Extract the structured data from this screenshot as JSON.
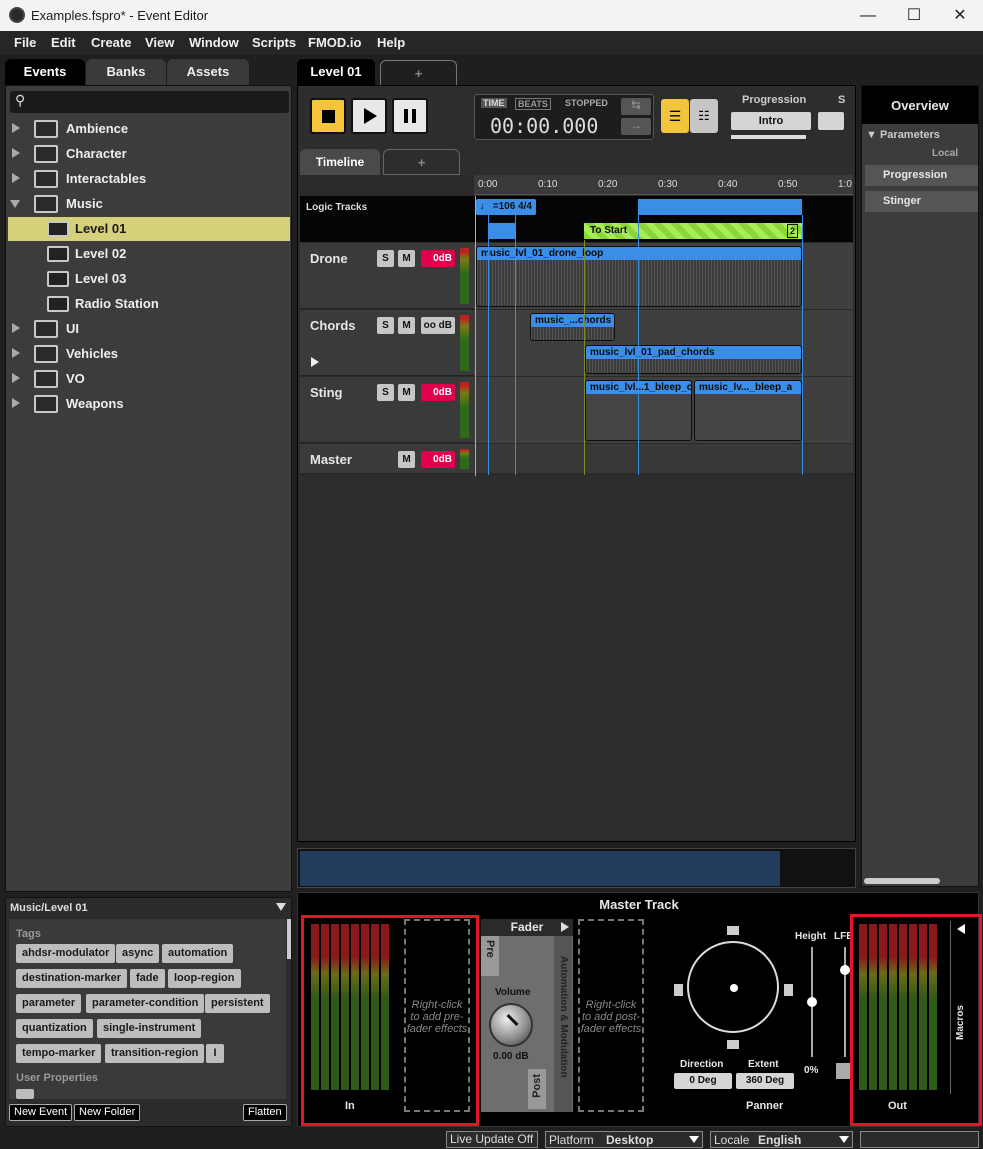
{
  "window": {
    "title": "Examples.fspro* - Event Editor",
    "minimize": "—",
    "maximize": "☐",
    "close": "✕"
  },
  "menu": [
    "File",
    "Edit",
    "Create",
    "View",
    "Window",
    "Scripts",
    "FMOD.io",
    "Help"
  ],
  "browser": {
    "tabs": [
      "Events",
      "Banks",
      "Assets"
    ],
    "search_placeholder": "",
    "tree": [
      {
        "label": "Ambience",
        "type": "folder",
        "expanded": false
      },
      {
        "label": "Character",
        "type": "folder",
        "expanded": false
      },
      {
        "label": "Interactables",
        "type": "folder",
        "expanded": false
      },
      {
        "label": "Music",
        "type": "folder",
        "expanded": true
      },
      {
        "label": "Level 01",
        "type": "event",
        "selected": true
      },
      {
        "label": "Level 02",
        "type": "event"
      },
      {
        "label": "Level 03",
        "type": "event"
      },
      {
        "label": "Radio Station",
        "type": "event"
      },
      {
        "label": "UI",
        "type": "folder",
        "expanded": false
      },
      {
        "label": "Vehicles",
        "type": "folder",
        "expanded": false
      },
      {
        "label": "VO",
        "type": "folder",
        "expanded": false
      },
      {
        "label": "Weapons",
        "type": "folder",
        "expanded": false
      }
    ]
  },
  "inspector": {
    "path": "Music/Level 01",
    "tags_label": "Tags",
    "tags": [
      "ahdsr-modulator",
      "async",
      "automation",
      "destination-marker",
      "fade",
      "loop-region",
      "parameter",
      "parameter-condition",
      "persistent",
      "quantization",
      "single-instrument",
      "tempo-marker",
      "transition-region"
    ],
    "user_properties_label": "User Properties",
    "buttons": {
      "new_event": "New Event",
      "new_folder": "New Folder",
      "flatten": "Flatten"
    }
  },
  "editor": {
    "tab": "Level 01",
    "add_tab": "+",
    "transport": {
      "time_label": "TIME",
      "beats_label": "BEATS",
      "state": "STOPPED",
      "time": "00:00.000"
    },
    "progression_label": "Progression",
    "progression_value": "Intro",
    "s_label": "S",
    "timeline_tab": "Timeline",
    "ruler": [
      "0:00",
      "0:10",
      "0:20",
      "0:30",
      "0:40",
      "0:50",
      "1:0"
    ],
    "logic_tracks": "Logic Tracks",
    "tempo": "=106 4/4",
    "to_start": "To Start",
    "to_start_count": "2",
    "tracks": [
      {
        "name": "Drone",
        "db": "0dB"
      },
      {
        "name": "Chords",
        "db": "oo dB"
      },
      {
        "name": "Sting",
        "db": "0dB"
      },
      {
        "name": "Master",
        "db": "0dB"
      }
    ],
    "solo": "S",
    "mute": "M",
    "regions": {
      "drone": "music_lvl_01_drone_loop",
      "chords1": "music_...chords",
      "chords2": "music_lvl_01_pad_chords",
      "sting1": "music_lvl...1_bleep_c",
      "sting2": "music_lv..._bleep_a"
    }
  },
  "overview": {
    "title": "Overview",
    "parameters": "Parameters",
    "local": "Local",
    "params": [
      "Progression",
      "Stinger"
    ]
  },
  "master": {
    "title": "Master Track",
    "in": "In",
    "prefader": "Right-click to add pre-fader effects",
    "fader": "Fader",
    "pre": "Pre",
    "post": "Post",
    "volume_label": "Volume",
    "volume_value": "0.00 dB",
    "automation": "Automation & Modulation",
    "postfader": "Right-click to add post-fader effects",
    "height": "Height",
    "lfe": "LFE",
    "pct": "0%",
    "direction_label": "Direction",
    "direction_value": "0 Deg",
    "extent_label": "Extent",
    "extent_value": "360 Deg",
    "panner": "Panner",
    "out": "Out",
    "macros": "Macros"
  },
  "status": {
    "live_update": "Live Update Off",
    "platform_label": "Platform",
    "platform_value": "Desktop",
    "locale_label": "Locale",
    "locale_value": "English"
  },
  "colors": {
    "selected": "#d5d07a",
    "accent_yellow": "#f2c53d",
    "region_blue": "#3a8ee8",
    "db_red": "#e0004d",
    "transition_green": "#8ad638",
    "highlight_red": "#e4142b"
  }
}
